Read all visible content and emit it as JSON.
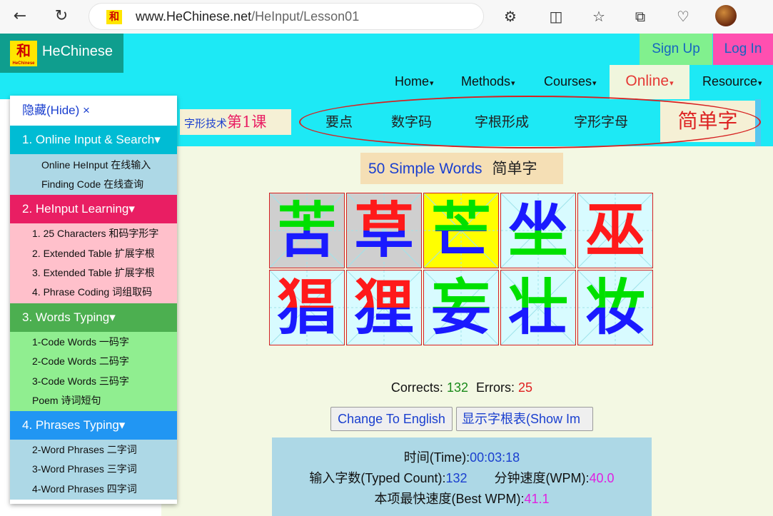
{
  "browser": {
    "url_host": "www.HeChinese.net",
    "url_path": "/HeInput/Lesson01",
    "favicon_text": "和"
  },
  "site": {
    "logo_text": "和",
    "logo_small": "HeChinese",
    "brand": "HeChinese",
    "signup": "Sign Up",
    "login": "Log In",
    "menu": [
      {
        "label": "Home",
        "caret": "▾"
      },
      {
        "label": "Methods",
        "caret": "▾"
      },
      {
        "label": "Courses",
        "caret": "▾"
      },
      {
        "label": "Online",
        "caret": "▾"
      },
      {
        "label": "Resource",
        "caret": "▾"
      }
    ]
  },
  "lesson_nav": {
    "label_prefix": "字形技术",
    "label_num": "第1课",
    "tabs": [
      "要点",
      "数字码",
      "字根形成",
      "字形字母"
    ],
    "active_tab": "简单字"
  },
  "sidebar": {
    "hide": "隐藏(Hide) ×",
    "sections": [
      {
        "title": "1. Online Input & Search",
        "caret": "▾",
        "color": "#00bcd4",
        "item_bg": "#add8e6",
        "items": [
          "Online HeInput 在线输入",
          "Finding Code 在线查询"
        ]
      },
      {
        "title": "2. HeInput Learning",
        "caret": "▾",
        "color": "#e91e63",
        "item_bg": "#ffc0cb",
        "items": [
          "1. 25 Characters 和码字形字",
          "2. Extended Table 扩展字根",
          "3. Extended Table 扩展字根",
          "4. Phrase Coding 词组取码"
        ]
      },
      {
        "title": "3. Words Typing",
        "caret": "▾",
        "color": "#4caf50",
        "item_bg": "#90ee90",
        "items": [
          "1-Code Words 一码字",
          "2-Code Words 二码字",
          "3-Code Words 三码字",
          "Poem 诗词短句"
        ]
      },
      {
        "title": "4. Phrases Typing",
        "caret": "▾",
        "color": "#2196f3",
        "item_bg": "#add8e6",
        "items": [
          "2-Word Phrases 二字词",
          "3-Word Phrases 三字词",
          "4-Word Phrases 四字词"
        ]
      }
    ]
  },
  "main": {
    "title_en": "50 Simple Words",
    "title_zh": "简单字",
    "characters": [
      {
        "char": "苦",
        "state": "done",
        "top": "#00e000",
        "bottom": "#1a1aff"
      },
      {
        "char": "草",
        "state": "done",
        "top": "#ff1a1a",
        "bottom": "#1a1aff"
      },
      {
        "char": "芒",
        "state": "current",
        "top": "#00e000",
        "bottom": "#1a1aff"
      },
      {
        "char": "坐",
        "state": "pending",
        "top": "#1a1aff",
        "bottom": "#00e000"
      },
      {
        "char": "巫",
        "state": "pending",
        "top": "#ff1a1a",
        "bottom": "#ff1a1a"
      },
      {
        "char": "猖",
        "state": "pending",
        "top": "#ff1a1a",
        "bottom": "#1a1aff"
      },
      {
        "char": "狸",
        "state": "pending",
        "top": "#ff1a1a",
        "bottom": "#1a1aff"
      },
      {
        "char": "妄",
        "state": "pending",
        "top": "#00e000",
        "bottom": "#1a1aff"
      },
      {
        "char": "壮",
        "state": "pending",
        "top": "#00e000",
        "bottom": "#1a1aff"
      },
      {
        "char": "妆",
        "state": "pending",
        "top": "#00e000",
        "bottom": "#1a1aff"
      }
    ],
    "corrects_label": "Corrects:",
    "corrects_value": "132",
    "errors_label": "Errors:",
    "errors_value": "25",
    "btn_english": "Change To English",
    "btn_show": "显示字根表(Show Im",
    "time_label": "时间(Time):",
    "time_value": "00:03:18",
    "typed_label": "输入字数(Typed Count):",
    "typed_value": "132",
    "wpm_label": "分钟速度(WPM):",
    "wpm_value": "40.0",
    "best_label": "本项最快速度(Best WPM):",
    "best_value": "41.1"
  },
  "colors": {
    "header": "#1de9f5",
    "brand_bg": "#0f9e8e",
    "cell_done": "#cfcfcf",
    "cell_current": "#ffff00",
    "cell_pending": "#d8fbff",
    "correct": "#1a8a1a",
    "error": "#e02020"
  }
}
